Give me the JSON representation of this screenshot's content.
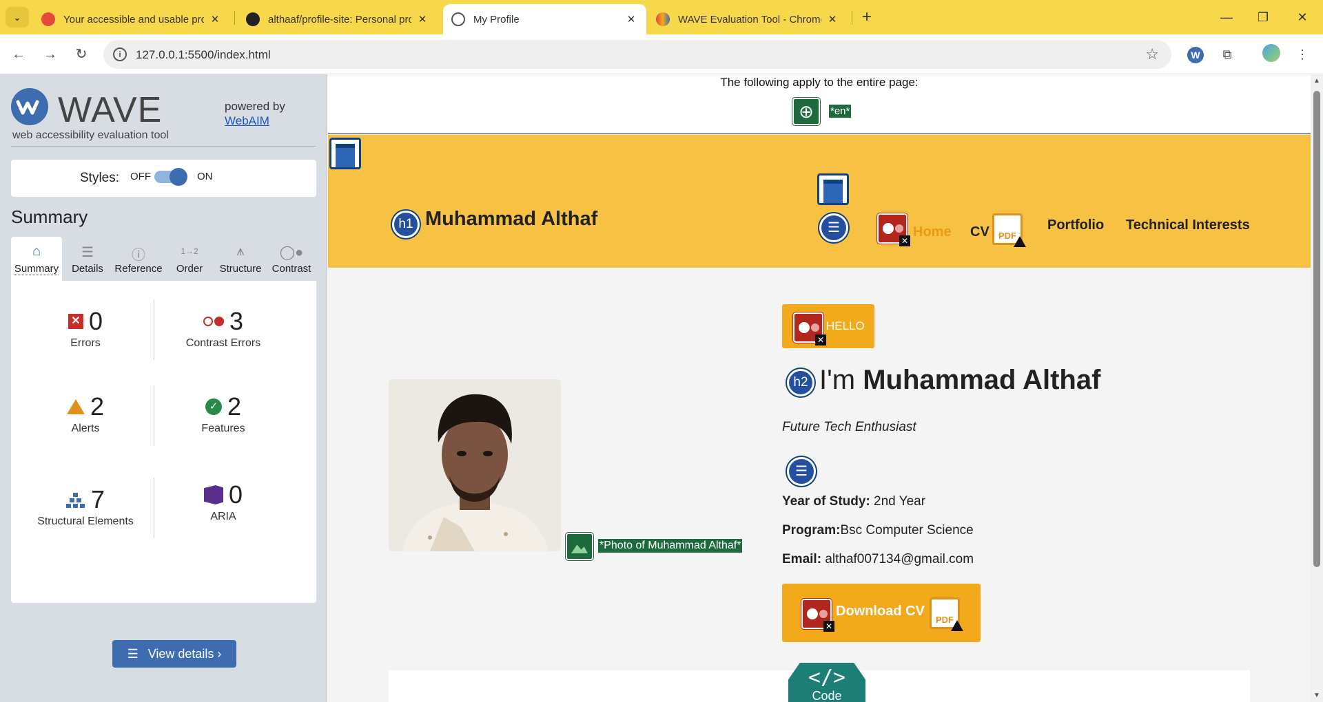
{
  "browser": {
    "tabs": [
      {
        "title": "Your accessible and usable prof",
        "active": false
      },
      {
        "title": "althaaf/profile-site: Personal prc",
        "active": false
      },
      {
        "title": "My Profile",
        "active": true
      },
      {
        "title": "WAVE Evaluation Tool - Chrome",
        "active": false
      }
    ],
    "url": "127.0.0.1:5500/index.html"
  },
  "wave": {
    "logo_text": "WAVE",
    "tagline": "web accessibility evaluation tool",
    "powered_by": "powered by",
    "webaim_link": "WebAIM",
    "styles_label": "Styles:",
    "styles_off": "OFF",
    "styles_on": "ON",
    "summary_heading": "Summary",
    "tabs": [
      {
        "label": "Summary",
        "icon": "home-icon"
      },
      {
        "label": "Details",
        "icon": "list-icon"
      },
      {
        "label": "Reference",
        "icon": "info-icon"
      },
      {
        "label": "Order",
        "icon": "order-icon"
      },
      {
        "label": "Structure",
        "icon": "structure-icon"
      },
      {
        "label": "Contrast",
        "icon": "contrast-icon"
      }
    ],
    "stats": {
      "errors": {
        "count": "0",
        "label": "Errors"
      },
      "contrast_errors": {
        "count": "3",
        "label": "Contrast Errors"
      },
      "alerts": {
        "count": "2",
        "label": "Alerts"
      },
      "features": {
        "count": "2",
        "label": "Features"
      },
      "structural": {
        "count": "7",
        "label": "Structural Elements"
      },
      "aria": {
        "count": "0",
        "label": "ARIA"
      }
    },
    "view_details": "View details ›"
  },
  "page": {
    "apply_text": "The following apply to the entire page:",
    "lang_tag": "*en*",
    "h1_badge": "h1",
    "h2_badge": "h2",
    "site_name": "Muhammad Althaf",
    "nav": {
      "home": "Home",
      "cv": "CV",
      "portfolio": "Portfolio",
      "technical": "Technical Interests"
    },
    "pdf_label": "PDF",
    "hello_button": "HELLO",
    "intro_prefix": "I'm",
    "intro_name": "Muhammad Althaf",
    "tagline": "Future Tech Enthusiast",
    "photo_alt": "*Photo of Muhammad Althaf*",
    "year_label": "Year of Study:",
    "year_value": "2nd Year",
    "program_label": "Program:",
    "program_value": "Bsc Computer Science",
    "email_label": "Email:",
    "email_value": "althaf007134@gmail.com",
    "download_cv": "Download CV",
    "code_symbol": "</>",
    "code_label": "Code"
  },
  "colors": {
    "browser_frame": "#f7d84b",
    "site_header": "#f7c244",
    "button_orange": "#f2a91c",
    "wave_blue": "#3d6cb1",
    "error_red": "#c62e2e",
    "feature_green": "#1d6b3d"
  }
}
